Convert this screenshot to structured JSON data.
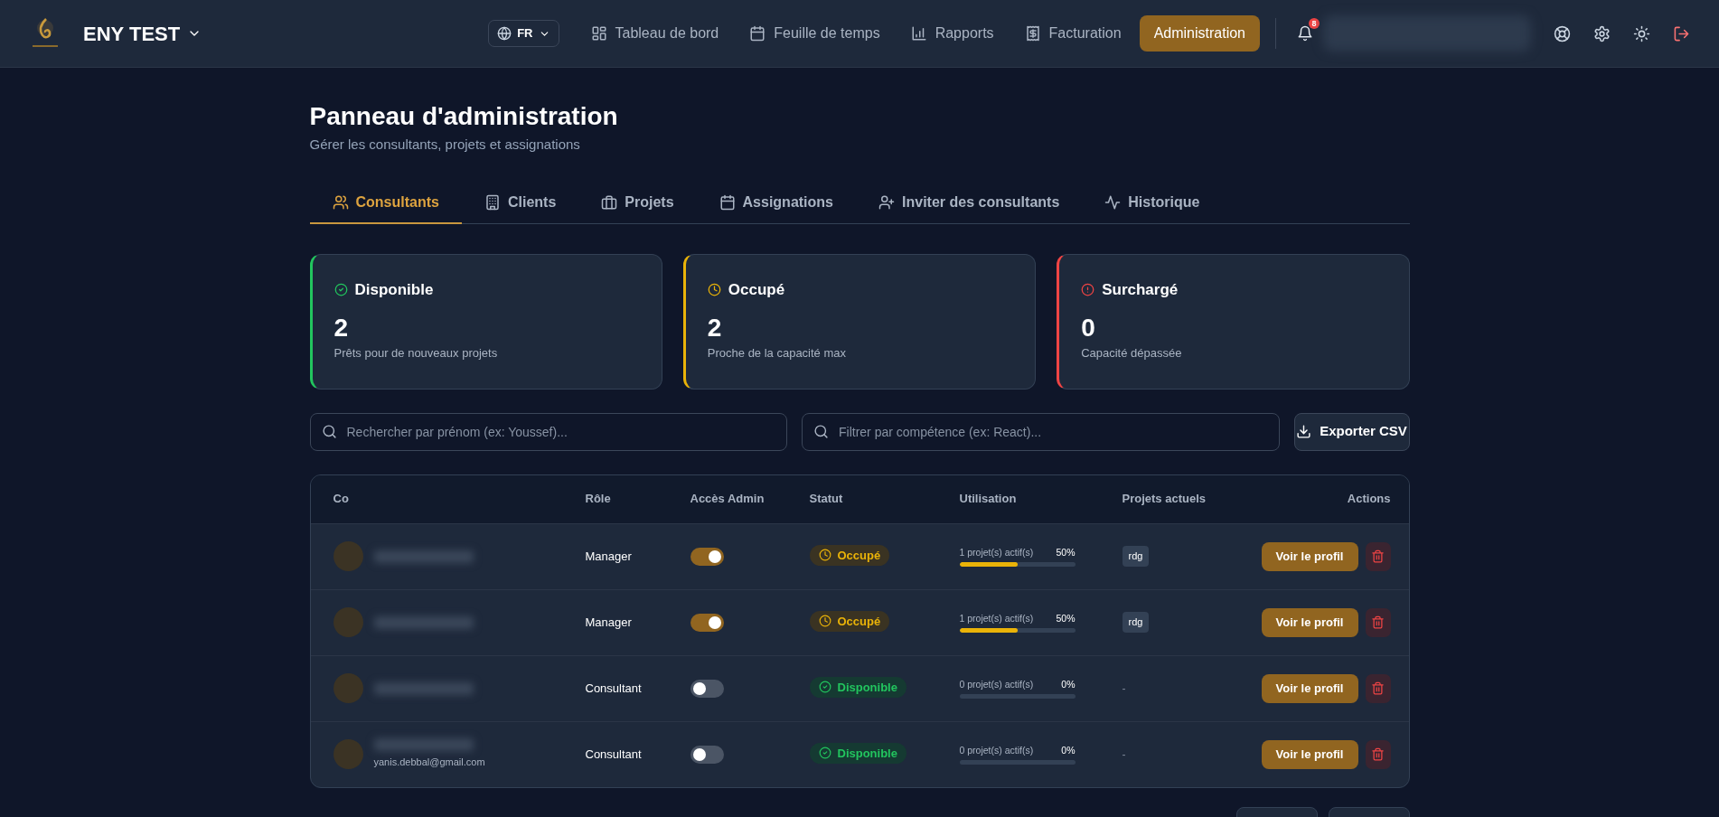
{
  "header": {
    "brand": "ENY TEST",
    "language": "FR",
    "notifications": "8",
    "nav": [
      {
        "label": "Tableau de bord",
        "selected": false
      },
      {
        "label": "Feuille de temps",
        "selected": false
      },
      {
        "label": "Rapports",
        "selected": false
      },
      {
        "label": "Facturation",
        "selected": false
      },
      {
        "label": "Administration",
        "selected": true
      }
    ]
  },
  "page": {
    "title": "Panneau d'administration",
    "subtitle": "Gérer les consultants, projets et assignations"
  },
  "tabs": [
    {
      "label": "Consultants",
      "selected": true
    },
    {
      "label": "Clients",
      "selected": false
    },
    {
      "label": "Projets",
      "selected": false
    },
    {
      "label": "Assignations",
      "selected": false
    },
    {
      "label": "Inviter des consultants",
      "selected": false
    },
    {
      "label": "Historique",
      "selected": false
    }
  ],
  "stats": [
    {
      "kind": "available",
      "title": "Disponible",
      "value": "2",
      "caption": "Prêts pour de nouveaux projets",
      "color": "#22c55e"
    },
    {
      "kind": "busy",
      "title": "Occupé",
      "value": "2",
      "caption": "Proche de la capacité max",
      "color": "#eab308"
    },
    {
      "kind": "overloaded",
      "title": "Surchargé",
      "value": "0",
      "caption": "Capacité dépassée",
      "color": "#ef4444"
    }
  ],
  "search": {
    "placeholder": "Rechercher par prénom (ex: Youssef)..."
  },
  "filter": {
    "placeholder": "Filtrer par compétence (ex: React)..."
  },
  "export_button": "Exporter CSV",
  "table": {
    "columns": [
      "Co",
      "Rôle",
      "Accès Admin",
      "Statut",
      "Utilisation",
      "Projets actuels",
      "Actions"
    ],
    "rows": [
      {
        "role": "Manager",
        "admin_access": true,
        "status": {
          "kind": "busy",
          "label": "Occupé"
        },
        "utilisation": {
          "text": "1 projet(s) actif(s)",
          "percent": "50%",
          "level": 0.5
        },
        "projects": [
          "rdg"
        ],
        "action": "Voir le profil"
      },
      {
        "role": "Manager",
        "admin_access": true,
        "status": {
          "kind": "busy",
          "label": "Occupé"
        },
        "utilisation": {
          "text": "1 projet(s) actif(s)",
          "percent": "50%",
          "level": 0.5
        },
        "projects": [
          "rdg"
        ],
        "action": "Voir le profil"
      },
      {
        "role": "Consultant",
        "admin_access": false,
        "status": {
          "kind": "available",
          "label": "Disponible"
        },
        "utilisation": {
          "text": "0 projet(s) actif(s)",
          "percent": "0%",
          "level": 0
        },
        "no_projects": "-",
        "action": "Voir le profil"
      },
      {
        "email": "yanis.debbal@gmail.com",
        "role": "Consultant",
        "admin_access": false,
        "status": {
          "kind": "available",
          "label": "Disponible"
        },
        "utilisation": {
          "text": "0 projet(s) actif(s)",
          "percent": "0%",
          "level": 0
        },
        "no_projects": "-",
        "action": "Voir le profil"
      }
    ]
  }
}
